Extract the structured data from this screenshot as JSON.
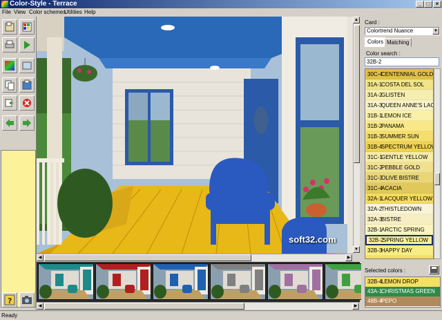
{
  "window": {
    "title": "Color-Style - Terrace",
    "min": "_",
    "max": "□",
    "close": "×"
  },
  "menu": [
    "File",
    "View",
    "Color schemes",
    "Utilities",
    "Help"
  ],
  "icons": {
    "toolbar": [
      "open-icon",
      "palette-icon",
      "print-icon",
      "play-icon",
      "gradient-icon",
      "layers-icon",
      "copy-icon",
      "paste-icon",
      "export-icon",
      "delete-icon",
      "back-icon",
      "forward-icon",
      "help-icon",
      "camera-icon"
    ]
  },
  "right_panel": {
    "card_label": "Card :",
    "card_value": "Colortrend Nuance",
    "tabs": [
      "Colors",
      "Matching"
    ],
    "search_label": "Color search :",
    "search_value": "32B-2",
    "colors": [
      {
        "code": "30C-4",
        "name": "CENTENNIAL GOLD",
        "hex": "#e0c048"
      },
      {
        "code": "31A-1",
        "name": "COSTA DEL SOL",
        "hex": "#f0e48a"
      },
      {
        "code": "31A-2",
        "name": "GLISTEN",
        "hex": "#f6eeb0"
      },
      {
        "code": "31A-3",
        "name": "QUEEN ANNE'S LACE",
        "hex": "#f8f2c6"
      },
      {
        "code": "31B-1",
        "name": "LEMON ICE",
        "hex": "#faf0a8"
      },
      {
        "code": "31B-2",
        "name": "PANAMA",
        "hex": "#f8e888"
      },
      {
        "code": "31B-3",
        "name": "SUMMER SUN",
        "hex": "#f4de6c"
      },
      {
        "code": "31B-4",
        "name": "SPECTRUM YELLOW",
        "hex": "#eed250"
      },
      {
        "code": "31C-1",
        "name": "GENTLE YELLOW",
        "hex": "#f6eca8"
      },
      {
        "code": "31C-2",
        "name": "PEBBLE GOLD",
        "hex": "#f0e090"
      },
      {
        "code": "31C-3",
        "name": "OLIVE BISTRE",
        "hex": "#e8d678"
      },
      {
        "code": "31C-4",
        "name": "ACACIA",
        "hex": "#e0c85c"
      },
      {
        "code": "32A-1",
        "name": "LACQUER YELLOW",
        "hex": "#f4dc5c"
      },
      {
        "code": "32A-2",
        "name": "THISTLEDOWN",
        "hex": "#faf4d8"
      },
      {
        "code": "32A-3",
        "name": "BISTRE",
        "hex": "#f8eec4"
      },
      {
        "code": "32B-1",
        "name": "ARCTIC SPRING",
        "hex": "#fbf4c0"
      },
      {
        "code": "32B-2",
        "name": "SPRING YELLOW",
        "hex": "#fbf29a"
      },
      {
        "code": "32B-3",
        "name": "HAPPY DAY",
        "hex": "#f8ec84"
      },
      {
        "code": "32B-4",
        "name": "LEMON DROP",
        "hex": "#f4e064"
      }
    ],
    "selected_index": 16,
    "selected_label": "Selected colors :",
    "selected_colors": [
      {
        "code": "32B-4",
        "name": "LEMON DROP",
        "hex": "#f4e064",
        "text": "#000"
      },
      {
        "code": "43A-1",
        "name": "CHRISTMAS GREEN",
        "hex": "#2e8a4a",
        "text": "#fff"
      },
      {
        "code": "48B-4",
        "name": "PEPO",
        "hex": "#b08a5a",
        "text": "#fff"
      }
    ]
  },
  "watermark": "soft32.com",
  "status": "Ready",
  "thumbnails": [
    {
      "accent": "#1e8a8a"
    },
    {
      "accent": "#b02020"
    },
    {
      "accent": "#2060b0"
    },
    {
      "accent": "#808080"
    },
    {
      "accent": "#a070a0"
    },
    {
      "accent": "#40a040"
    }
  ]
}
